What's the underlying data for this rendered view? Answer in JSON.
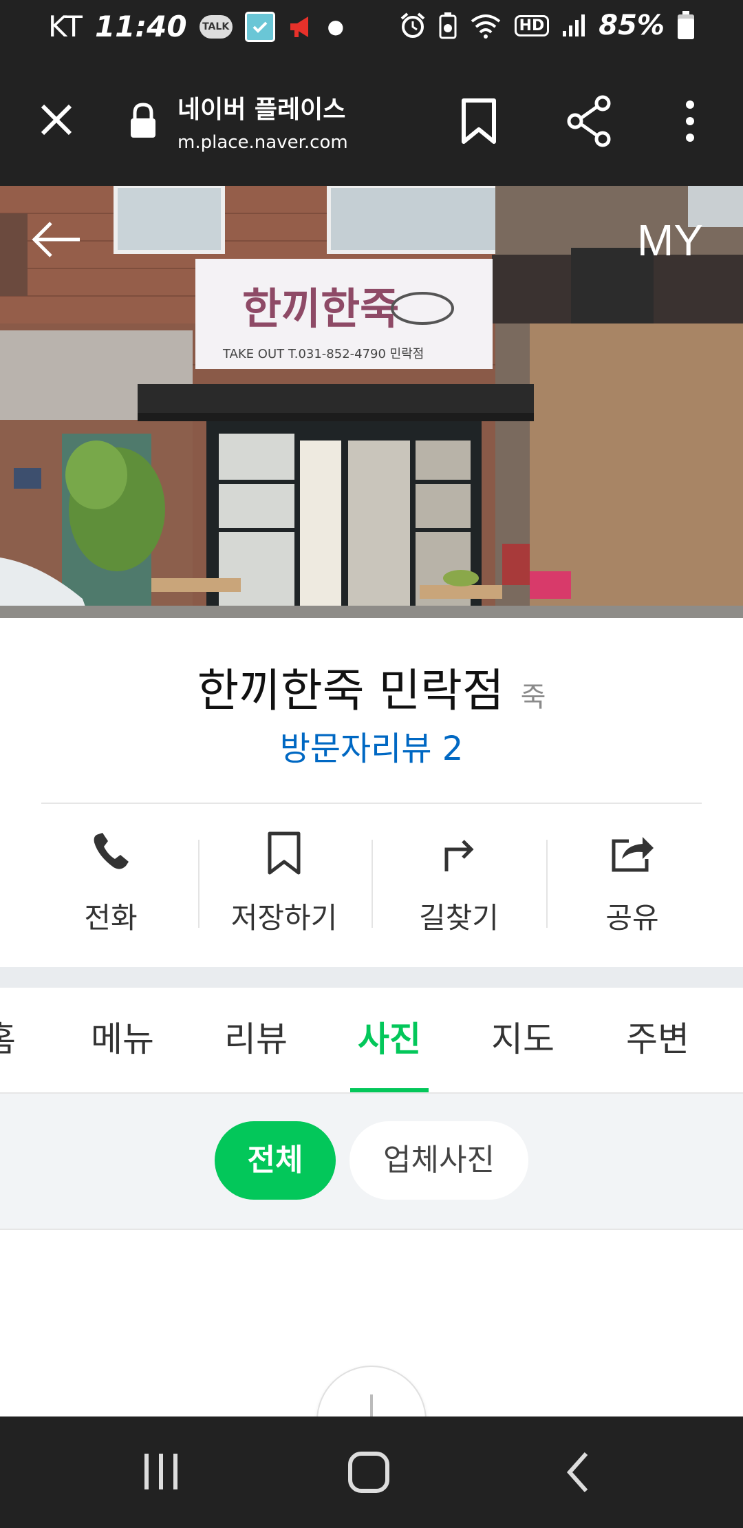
{
  "status_bar": {
    "carrier": "KT",
    "time": "11:40",
    "talk_label": "TALK",
    "network": "HD",
    "battery": "85%"
  },
  "browser": {
    "site_title": "네이버 플레이스",
    "url": "m.place.naver.com"
  },
  "hero": {
    "my_label": "MY",
    "sign_name": "한끼한죽",
    "sign_sub": "TAKE OUT    T.031-852-4790    민락점"
  },
  "place": {
    "name": "한끼한죽 민락점",
    "category": "죽",
    "review_link": "방문자리뷰 2"
  },
  "actions": [
    {
      "label": "전화",
      "icon": "phone-icon"
    },
    {
      "label": "저장하기",
      "icon": "bookmark-icon"
    },
    {
      "label": "길찾기",
      "icon": "directions-icon"
    },
    {
      "label": "공유",
      "icon": "share-icon"
    }
  ],
  "tabs": [
    {
      "label": "홈"
    },
    {
      "label": "메뉴"
    },
    {
      "label": "리뷰"
    },
    {
      "label": "사진",
      "active": true
    },
    {
      "label": "지도"
    },
    {
      "label": "주변"
    }
  ],
  "filters": [
    {
      "label": "전체",
      "active": true
    },
    {
      "label": "업체사진",
      "active": false
    }
  ],
  "colors": {
    "accent": "#03c75a",
    "link": "#0068c3",
    "bar": "#222222"
  }
}
